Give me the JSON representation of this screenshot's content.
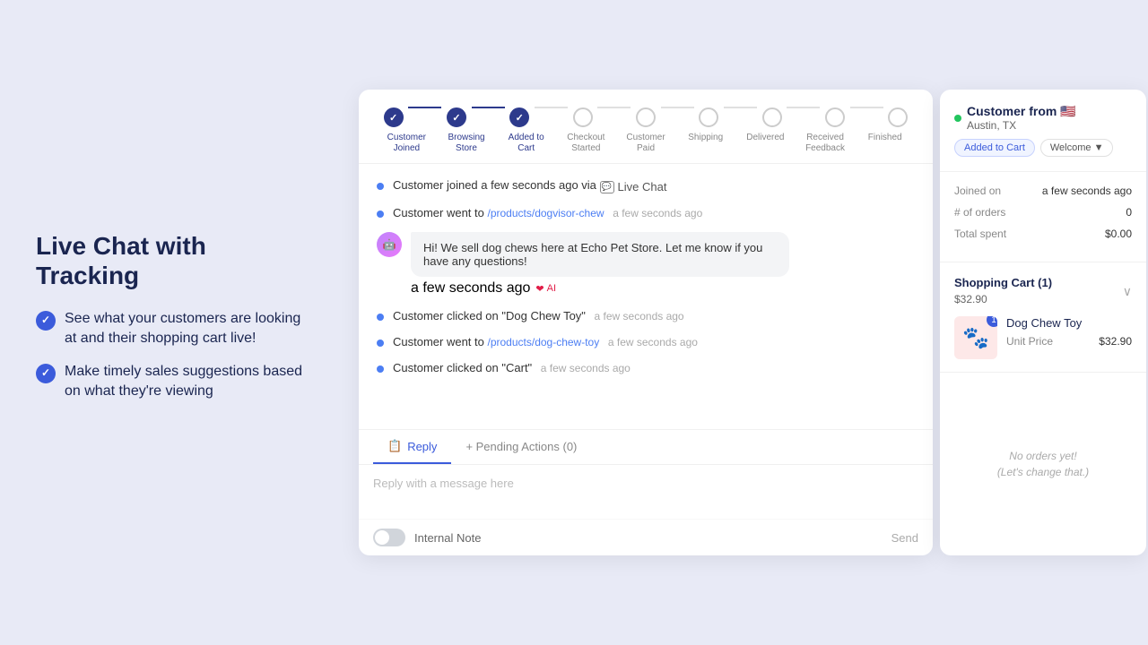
{
  "left": {
    "title": "Live Chat with Tracking",
    "features": [
      "See what your customers are looking at and their shopping cart live!",
      "Make timely sales suggestions based on what they're viewing"
    ]
  },
  "stepper": {
    "steps": [
      {
        "label": "Customer\nJoined",
        "state": "completed"
      },
      {
        "label": "Browsing\nStore",
        "state": "completed"
      },
      {
        "label": "Added to\nCart",
        "state": "completed"
      },
      {
        "label": "Checkout\nStarted",
        "state": "inactive"
      },
      {
        "label": "Customer\nPaid",
        "state": "inactive"
      },
      {
        "label": "Shipping",
        "state": "inactive"
      },
      {
        "label": "Delivered",
        "state": "inactive"
      },
      {
        "label": "Received\nFeedback",
        "state": "inactive"
      },
      {
        "label": "Finished",
        "state": "inactive"
      }
    ]
  },
  "activities": [
    {
      "text": "Customer joined a few seconds ago via",
      "badge": "Live Chat",
      "timestamp": ""
    },
    {
      "text": "Customer went to",
      "link": "/products/dogvisor-chew",
      "timestamp": "a few seconds ago"
    },
    {
      "message": "Hi! We sell dog chews here at Echo Pet Store. Let me know if you have any questions!",
      "timestamp": "a few seconds ago",
      "ai_label": "AI"
    },
    {
      "text": "Customer clicked on \"Dog Chew Toy\"",
      "timestamp": "a few seconds ago"
    },
    {
      "text": "Customer went to",
      "link": "/products/dog-chew-toy",
      "timestamp": "a few seconds ago"
    },
    {
      "text": "Customer clicked on \"Cart\"",
      "timestamp": "a few seconds ago"
    }
  ],
  "reply": {
    "tab_reply": "Reply",
    "tab_pending": "+ Pending Actions (0)",
    "placeholder": "Reply with a message here",
    "internal_note_label": "Internal Note",
    "send_label": "Send"
  },
  "customer": {
    "name": "Customer from",
    "flag": "🇺🇸",
    "location": "Austin, TX",
    "tags": [
      "Added to Cart",
      "Welcome"
    ],
    "joined_label": "Joined on",
    "joined_value": "a few seconds ago",
    "orders_label": "# of orders",
    "orders_value": "0",
    "total_label": "Total spent",
    "total_value": "$0.00"
  },
  "cart": {
    "title": "Shopping Cart (1)",
    "total": "$32.90",
    "item_name": "Dog Chew Toy",
    "unit_price_label": "Unit Price",
    "unit_price_value": "$32.90",
    "quantity": "1"
  },
  "orders": {
    "empty_line1": "No orders yet!",
    "empty_line2": "(Let's change that.)"
  }
}
